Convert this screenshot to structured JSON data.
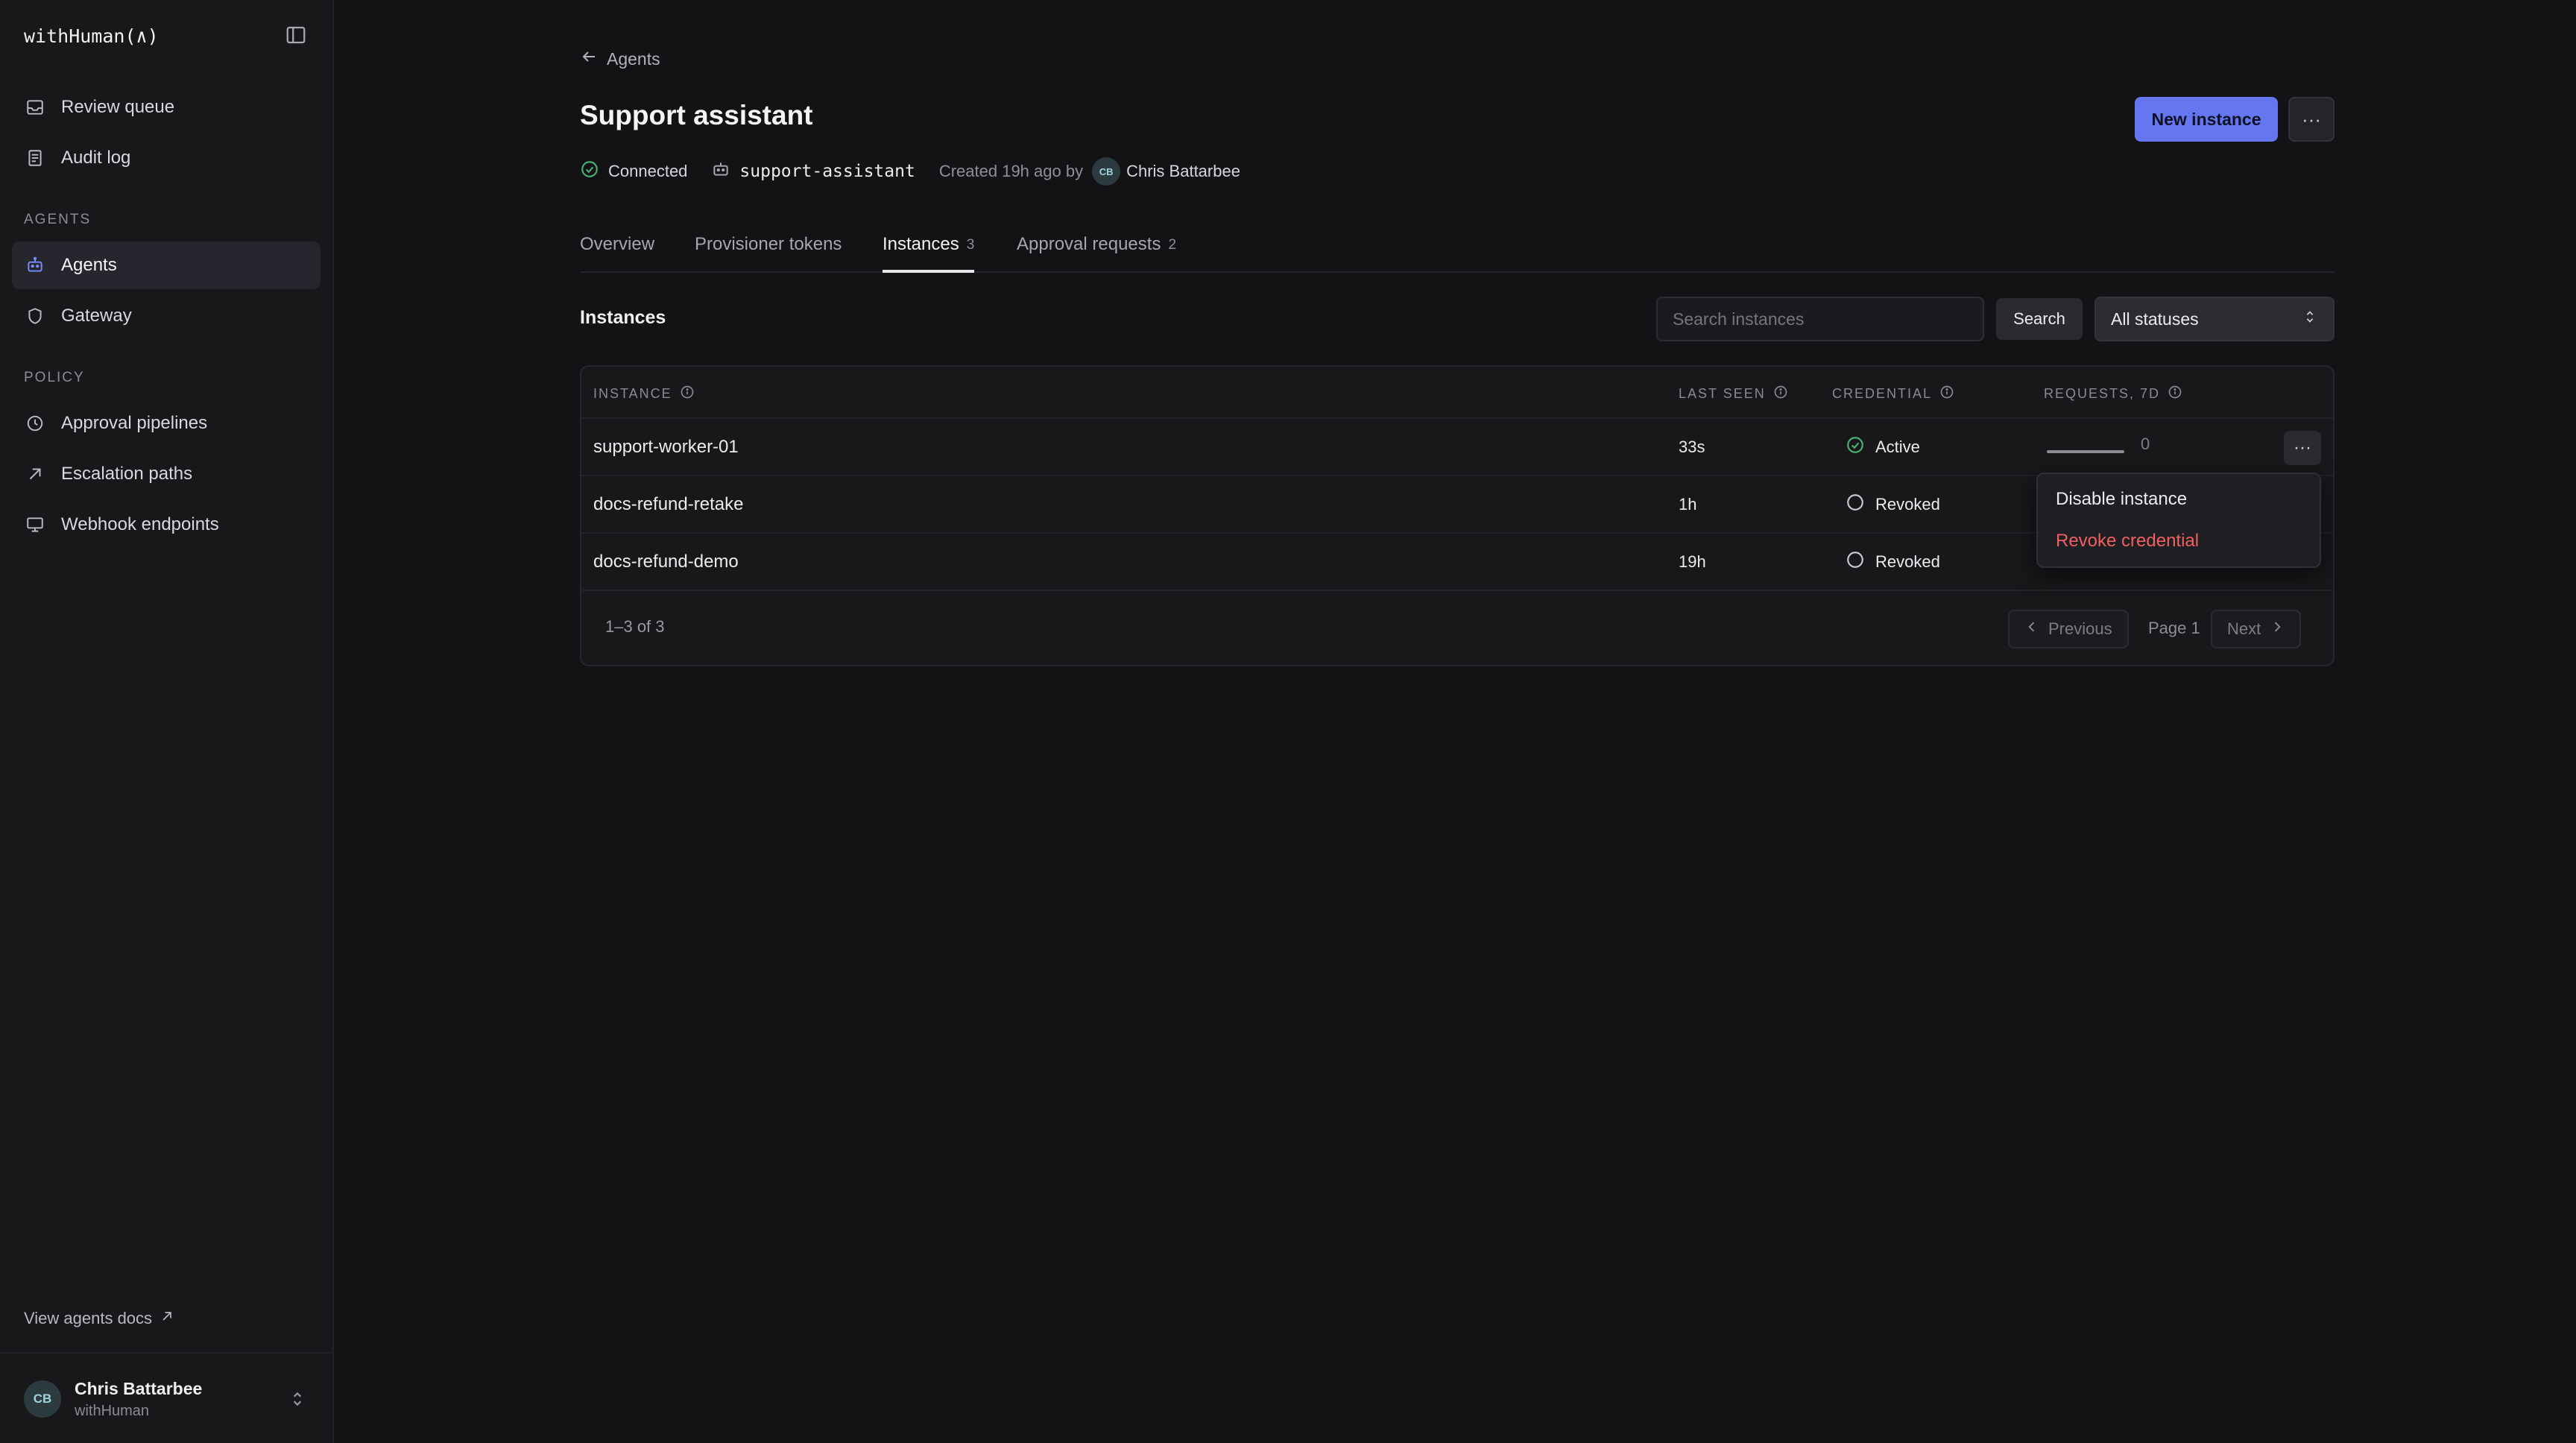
{
  "app": {
    "brand": "withHuman(∧)"
  },
  "sidebar": {
    "primary": [
      {
        "label": "Review queue",
        "icon": "inbox-icon"
      },
      {
        "label": "Audit log",
        "icon": "document-icon"
      }
    ],
    "sections": [
      {
        "title": "AGENTS",
        "items": [
          {
            "label": "Agents",
            "icon": "robot-icon",
            "active": true
          },
          {
            "label": "Gateway",
            "icon": "shield-icon"
          }
        ]
      },
      {
        "title": "POLICY",
        "items": [
          {
            "label": "Approval pipelines",
            "icon": "clock-icon"
          },
          {
            "label": "Escalation paths",
            "icon": "arrow-up-right-icon"
          },
          {
            "label": "Webhook endpoints",
            "icon": "monitor-icon"
          }
        ]
      }
    ],
    "docs_link": "View agents docs",
    "user": {
      "initials": "CB",
      "name": "Chris Battarbee",
      "org": "withHuman"
    }
  },
  "header": {
    "breadcrumb": "Agents",
    "title": "Support assistant",
    "new_instance_label": "New instance",
    "more_label": "···",
    "meta": {
      "status": "Connected",
      "slug": "support-assistant",
      "created_prefix": "Created 19h ago by",
      "creator_initials": "CB",
      "creator_name": "Chris Battarbee"
    }
  },
  "tabs": [
    {
      "label": "Overview",
      "count": ""
    },
    {
      "label": "Provisioner tokens",
      "count": ""
    },
    {
      "label": "Instances",
      "count": "3",
      "active": true
    },
    {
      "label": "Approval requests",
      "count": "2"
    }
  ],
  "instances": {
    "title": "Instances",
    "search_placeholder": "Search instances",
    "search_label": "Search",
    "status_filter": "All statuses",
    "columns": {
      "instance": "INSTANCE",
      "last_seen": "LAST SEEN",
      "credential": "CREDENTIAL",
      "requests": "REQUESTS, 7D"
    },
    "rows": [
      {
        "name": "support-worker-01",
        "last_seen": "33s",
        "credential": "Active",
        "requests": "0"
      },
      {
        "name": "docs-refund-retake",
        "last_seen": "1h",
        "credential": "Revoked",
        "requests": ""
      },
      {
        "name": "docs-refund-demo",
        "last_seen": "19h",
        "credential": "Revoked",
        "requests": ""
      }
    ],
    "range": "1–3 of 3",
    "pagination": {
      "previous": "Previous",
      "page": "Page 1",
      "next": "Next"
    }
  },
  "row_menu": {
    "items": [
      "Disable instance",
      "Revoke credential"
    ]
  },
  "colors": {
    "accent": "#6577f0",
    "success": "#4caf72",
    "danger": "#f25f5f",
    "background": "#131315"
  }
}
